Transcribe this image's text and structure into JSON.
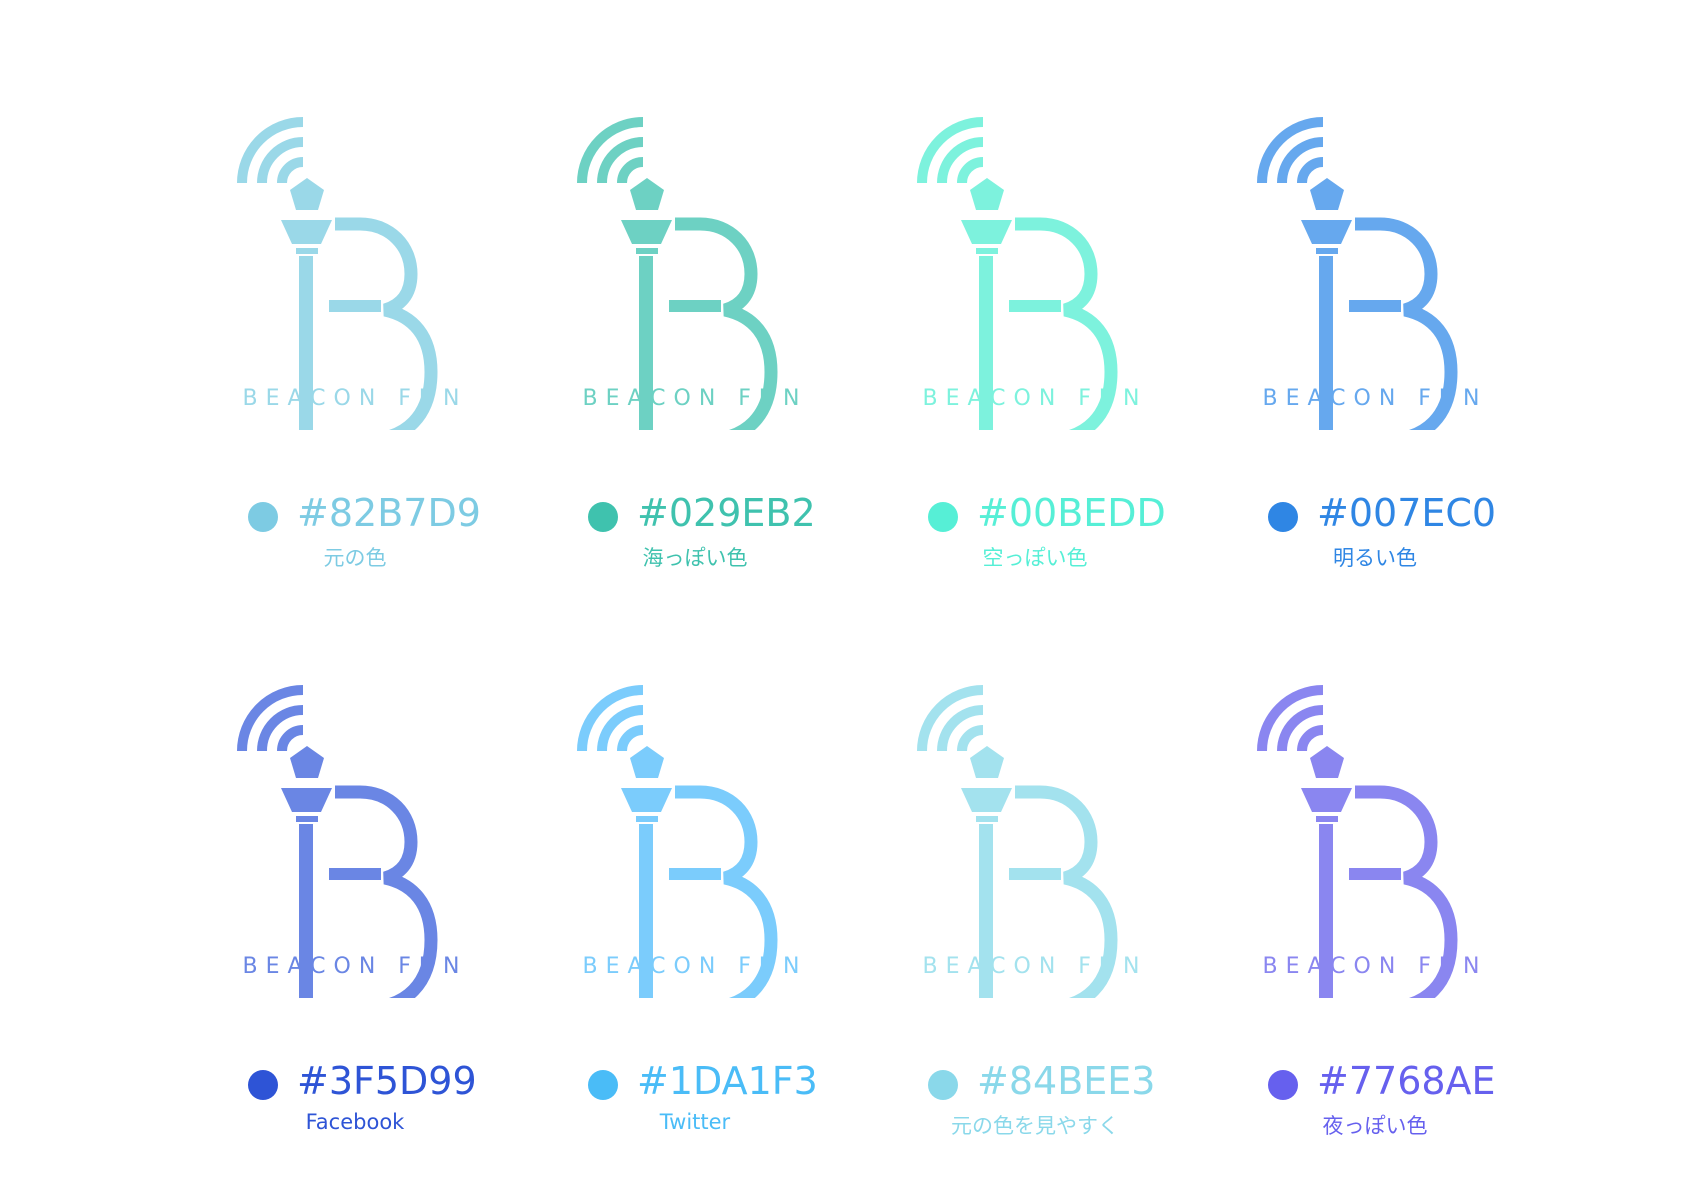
{
  "variants": [
    {
      "wordmark": "BEACON FUN",
      "hex": "#82B7D9",
      "note": "元の色",
      "logo_color": "#9AD8E8",
      "swatch_color": "#7DCBE3",
      "text_color": "#7DCBE3"
    },
    {
      "wordmark": "BEACON FUN",
      "hex": "#029EB2",
      "note": "海っぽい色",
      "logo_color": "#6DD1C3",
      "swatch_color": "#3FC2AE",
      "text_color": "#3FC2AE"
    },
    {
      "wordmark": "BEACON FUN",
      "hex": "#00BEDD",
      "note": "空っぽい色",
      "logo_color": "#7DF2DD",
      "swatch_color": "#56EFD6",
      "text_color": "#56EFD6"
    },
    {
      "wordmark": "BEACON FUN",
      "hex": "#007EC0",
      "note": "明るい色",
      "logo_color": "#66A8EE",
      "swatch_color": "#2F86E4",
      "text_color": "#2F86E4"
    },
    {
      "wordmark": "BEACON FUN",
      "hex": "#3F5D99",
      "note": "Facebook",
      "logo_color": "#6A86E4",
      "swatch_color": "#2E54D6",
      "text_color": "#2E54D6"
    },
    {
      "wordmark": "BEACON FUN",
      "hex": "#1DA1F3",
      "note": "Twitter",
      "logo_color": "#7BCCFC",
      "swatch_color": "#4ABCF7",
      "text_color": "#4ABCF7"
    },
    {
      "wordmark": "BEACON FUN",
      "hex": "#84BEE3",
      "note": "元の色を見やすく",
      "logo_color": "#A3E2EE",
      "swatch_color": "#8AD8EA",
      "text_color": "#8AD8EA"
    },
    {
      "wordmark": "BEACON FUN",
      "hex": "#7768AE",
      "note": "夜っぽい色",
      "logo_color": "#8A86F0",
      "swatch_color": "#6660EE",
      "text_color": "#6660EE"
    }
  ]
}
